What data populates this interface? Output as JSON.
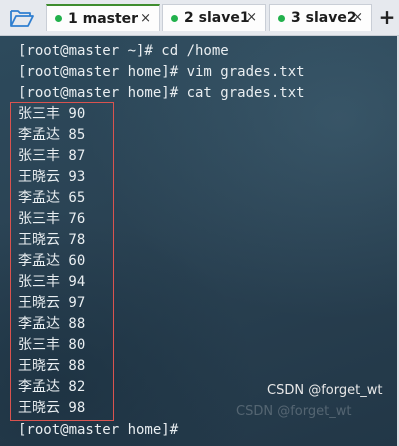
{
  "tabs": [
    {
      "label": "1 master",
      "active": true
    },
    {
      "label": "2 slave1",
      "active": false
    },
    {
      "label": "3 slave2",
      "active": false
    }
  ],
  "tab_close_glyph": "×",
  "new_tab_glyph": "+",
  "icons": {
    "open_folder": "folder-open-icon",
    "status_dot": "connected-dot-icon"
  },
  "colors": {
    "status_dot": "#22b14c",
    "highlight_box": "#d9534f",
    "terminal_bg": "#2a4456"
  },
  "terminal": {
    "commands": [
      "[root@master ~]# cd /home",
      "[root@master home]# vim grades.txt",
      "[root@master home]# cat grades.txt"
    ],
    "output": [
      "张三丰 90",
      "李孟达 85",
      "张三丰 87",
      "王晓云 93",
      "李孟达 65",
      "张三丰 76",
      "王晓云 78",
      "李孟达 60",
      "张三丰 94",
      "王晓云 97",
      "李孟达 88",
      "张三丰 80",
      "王晓云 88",
      "李孟达 82",
      "王晓云 98"
    ],
    "final_prompt": "[root@master home]#",
    "watermark": "CSDN @forget_wt",
    "watermark_ghost": "CSDN @forget_wt"
  }
}
